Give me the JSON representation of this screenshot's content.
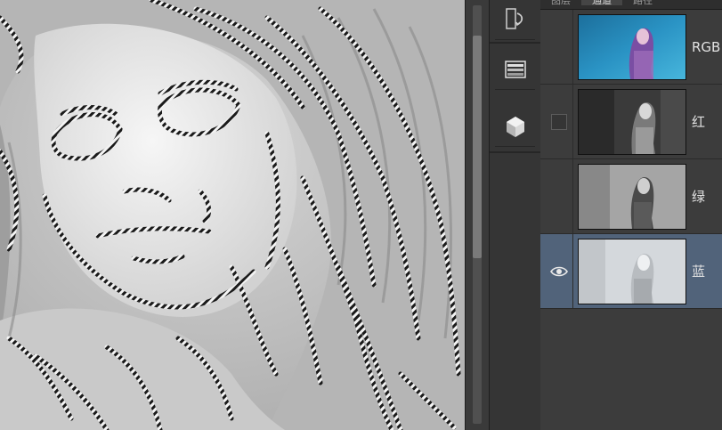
{
  "panel": {
    "tabs": [
      {
        "label": "图层"
      },
      {
        "label": "通道"
      },
      {
        "label": "路径"
      }
    ],
    "channels": [
      {
        "label": "RGB",
        "visible": false
      },
      {
        "label": "红",
        "visible": false
      },
      {
        "label": "绿",
        "visible": false
      },
      {
        "label": "蓝",
        "visible": true
      }
    ]
  },
  "dock": {
    "icons": [
      "history-icon",
      "channels-icon",
      "3d-cube-icon"
    ]
  },
  "colors": {
    "selected_row": "#51637a",
    "rgb_thumb": "#2a93c4"
  }
}
